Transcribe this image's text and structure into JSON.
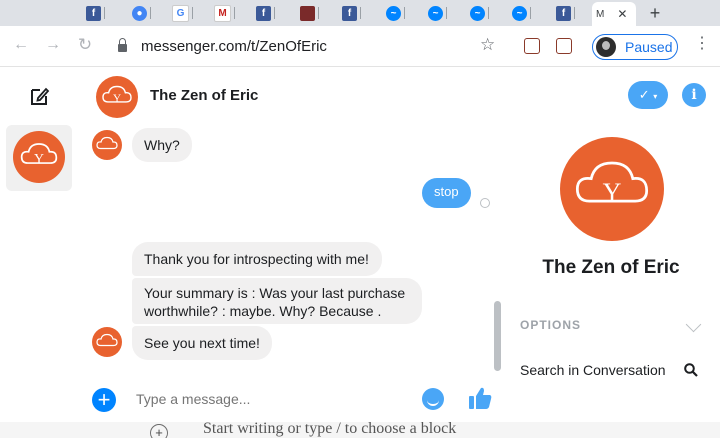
{
  "browser": {
    "tabs": [
      {
        "icon": "facebook-icon",
        "glyph": "f",
        "color": "#3b5998"
      },
      {
        "icon": "account-icon",
        "glyph": "●",
        "color": "#4285f4"
      },
      {
        "icon": "google-icon",
        "glyph": "G",
        "color": "#ffffff"
      },
      {
        "icon": "gmail-icon",
        "glyph": "M",
        "color": "#ffffff"
      },
      {
        "icon": "facebook-icon",
        "glyph": "f",
        "color": "#3b5998"
      },
      {
        "icon": "photo-icon",
        "glyph": "",
        "color": "#7a2a2a"
      },
      {
        "icon": "facebook-icon",
        "glyph": "f",
        "color": "#3b5998"
      },
      {
        "icon": "messenger-icon",
        "glyph": "~",
        "color": "#0084ff"
      },
      {
        "icon": "messenger-icon",
        "glyph": "~",
        "color": "#0084ff"
      },
      {
        "icon": "messenger-icon",
        "glyph": "~",
        "color": "#0084ff"
      },
      {
        "icon": "messenger-icon",
        "glyph": "~",
        "color": "#0084ff"
      },
      {
        "icon": "facebook-icon",
        "glyph": "f",
        "color": "#3b5998"
      }
    ],
    "active_tab_label": "M",
    "active_tab_close": "✕",
    "new_tab": "+",
    "url": "messenger.com/t/ZenOfEric",
    "profile_status": "Paused"
  },
  "conversation": {
    "name": "The Zen of Eric",
    "avatar_letter": "Y",
    "composer_placeholder": "Type a message...",
    "messages": [
      {
        "from": "bot",
        "text": "Why?"
      },
      {
        "from": "me",
        "text": "stop"
      },
      {
        "from": "bot",
        "text": "Thank you for introspecting with me!"
      },
      {
        "from": "bot",
        "text": "Your summary is : Was your last purchase worthwhile? :  maybe. Why? Because ."
      },
      {
        "from": "bot",
        "text": "See you next time!"
      }
    ]
  },
  "details": {
    "name": "The Zen of Eric",
    "options_label": "OPTIONS",
    "search_label": "Search in Conversation",
    "toggle_glyph": "✓"
  },
  "editor_hint": {
    "plus": "+",
    "text": "Start writing or type / to choose a block"
  },
  "colors": {
    "accent": "#0084ff",
    "bubble_out": "#4aa6f6",
    "avatar_orange": "#e8622f"
  }
}
